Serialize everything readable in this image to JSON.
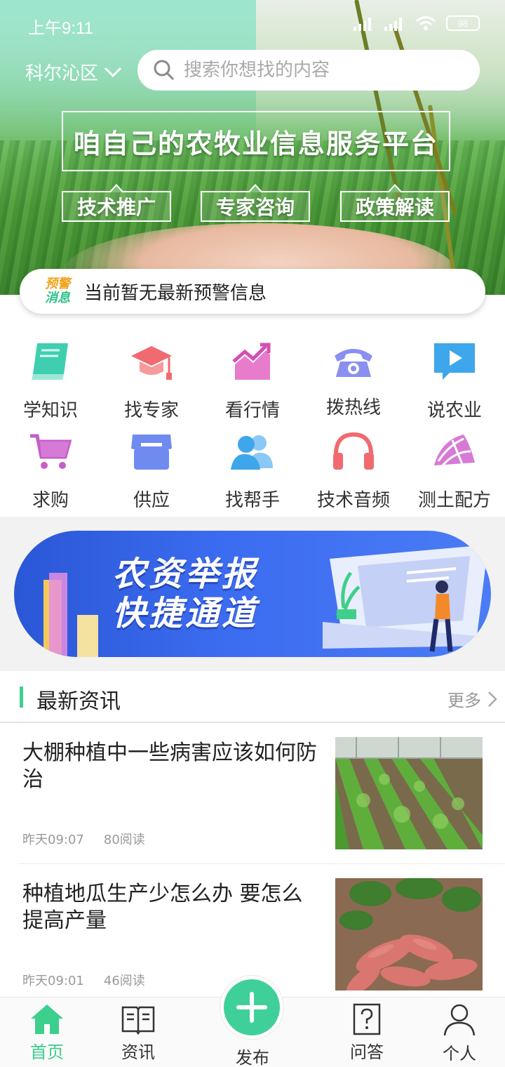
{
  "status": {
    "time": "上午9:11",
    "battery": "98"
  },
  "header": {
    "region": "科尔沁区",
    "search_placeholder": "搜索你想找的内容"
  },
  "hero": {
    "title": "咱自己的农牧业信息服务平台",
    "tags": [
      "技术推广",
      "专家咨询",
      "政策解读"
    ]
  },
  "alert": {
    "badge_top": "预警",
    "badge_bottom": "消息",
    "text": "当前暂无最新预警信息"
  },
  "services": [
    {
      "label": "学知识",
      "icon": "book-icon"
    },
    {
      "label": "找专家",
      "icon": "graduation-cap-icon"
    },
    {
      "label": "看行情",
      "icon": "trend-chart-icon"
    },
    {
      "label": "拨热线",
      "icon": "telephone-icon"
    },
    {
      "label": "说农业",
      "icon": "video-play-icon"
    },
    {
      "label": "求购",
      "icon": "shopping-cart-icon"
    },
    {
      "label": "供应",
      "icon": "store-icon"
    },
    {
      "label": "找帮手",
      "icon": "people-icon"
    },
    {
      "label": "技术音频",
      "icon": "headphones-icon"
    },
    {
      "label": "测土配方",
      "icon": "soil-test-icon"
    }
  ],
  "banner": {
    "line1": "农资举报",
    "line2": "快捷通道"
  },
  "news": {
    "section_title": "最新资讯",
    "more": "更多",
    "items": [
      {
        "title": "大棚种植中一些病害应该如何防治",
        "time": "昨天09:07",
        "reads": "80阅读"
      },
      {
        "title": "种植地瓜生产少怎么办 要怎么提高产量",
        "time": "昨天09:01",
        "reads": "46阅读"
      }
    ]
  },
  "tabbar": {
    "home": "首页",
    "news": "资讯",
    "publish": "发布",
    "qa": "问答",
    "profile": "个人"
  },
  "colors": {
    "accent": "#3ccf8e",
    "banner_blue": "#3c6cf0",
    "alert_orange": "#f2a31b"
  }
}
